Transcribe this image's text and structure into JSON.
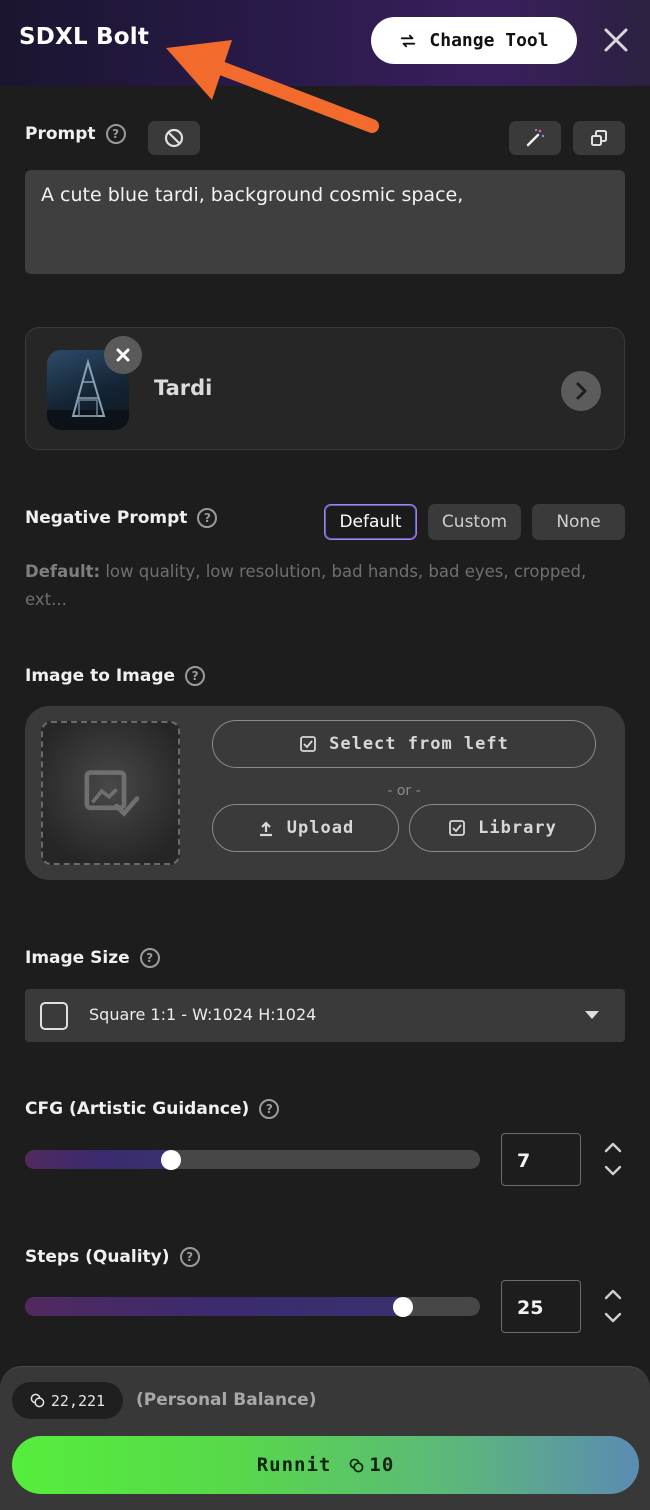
{
  "header": {
    "title": "SDXL Bolt",
    "change_tool_label": "Change Tool"
  },
  "prompt": {
    "label": "Prompt",
    "value": "A cute blue tardi, background cosmic space,"
  },
  "model": {
    "name": "Tardi"
  },
  "negative_prompt": {
    "label": "Negative Prompt",
    "options": [
      "Default",
      "Custom",
      "None"
    ],
    "selected": "Default",
    "default_prefix": "Default:",
    "default_text": " low quality, low resolution, bad hands, bad eyes, cropped, ext..."
  },
  "image_to_image": {
    "label": "Image to Image",
    "select_label": "Select from left",
    "or_label": "- or -",
    "upload_label": "Upload",
    "library_label": "Library"
  },
  "image_size": {
    "label": "Image Size",
    "value": "Square 1:1 - W:1024 H:1024"
  },
  "cfg": {
    "label": "CFG (Artistic Guidance)",
    "value": "7",
    "fill_fraction": 0.32
  },
  "steps": {
    "label": "Steps (Quality)",
    "value": "25",
    "fill_fraction": 0.83
  },
  "footer": {
    "balance": "22,221",
    "balance_label": "(Personal Balance)",
    "run_label": "Runnit",
    "run_cost": "10"
  },
  "colors": {
    "accent_purple": "#512a5e",
    "run_green": "#55ee3c",
    "run_blue": "#5b8bb3",
    "annotation_arrow": "#f26a2c"
  },
  "icons": [
    "swap-arrows-icon",
    "close-icon",
    "help-icon",
    "clear-icon",
    "magic-wand-icon",
    "copy-icon",
    "chevron-right-icon",
    "image-placeholder-icon",
    "checkbox-icon",
    "upload-icon",
    "caret-down-icon",
    "stepper-icon",
    "coin-icon"
  ]
}
